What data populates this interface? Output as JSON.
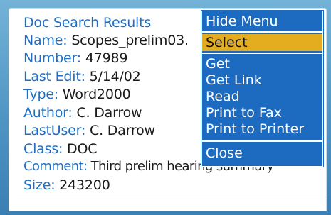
{
  "screen": {
    "title": "Doc Search Results",
    "fields": [
      {
        "label": "Name:",
        "value": "Scopes_prelim03."
      },
      {
        "label": "Number:",
        "value": "47989"
      },
      {
        "label": "Last Edit:",
        "value": "5/14/02"
      },
      {
        "label": "Type:",
        "value": "Word2000"
      },
      {
        "label": "Author:",
        "value": "C. Darrow"
      },
      {
        "label": "LastUser:",
        "value": "C. Darrow"
      },
      {
        "label": "Class:",
        "value": "DOC"
      },
      {
        "label": "Comment:",
        "value": "Third prelim hearing summary"
      },
      {
        "label": "Size:",
        "value": "243200"
      }
    ]
  },
  "menu": {
    "items": [
      {
        "label": "Hide Menu"
      },
      {
        "label": "Select",
        "selected": true
      },
      {
        "label": "Get"
      },
      {
        "label": "Get Link"
      },
      {
        "label": "Read"
      },
      {
        "label": "Print to Fax"
      },
      {
        "label": "Print to Printer"
      },
      {
        "label": "Close"
      }
    ]
  },
  "colors": {
    "label_blue": "#1f6ec2",
    "menu_bg": "#1d6bc0",
    "menu_highlight": "#e4ac1f",
    "frame_blue": "#4f95c4"
  }
}
